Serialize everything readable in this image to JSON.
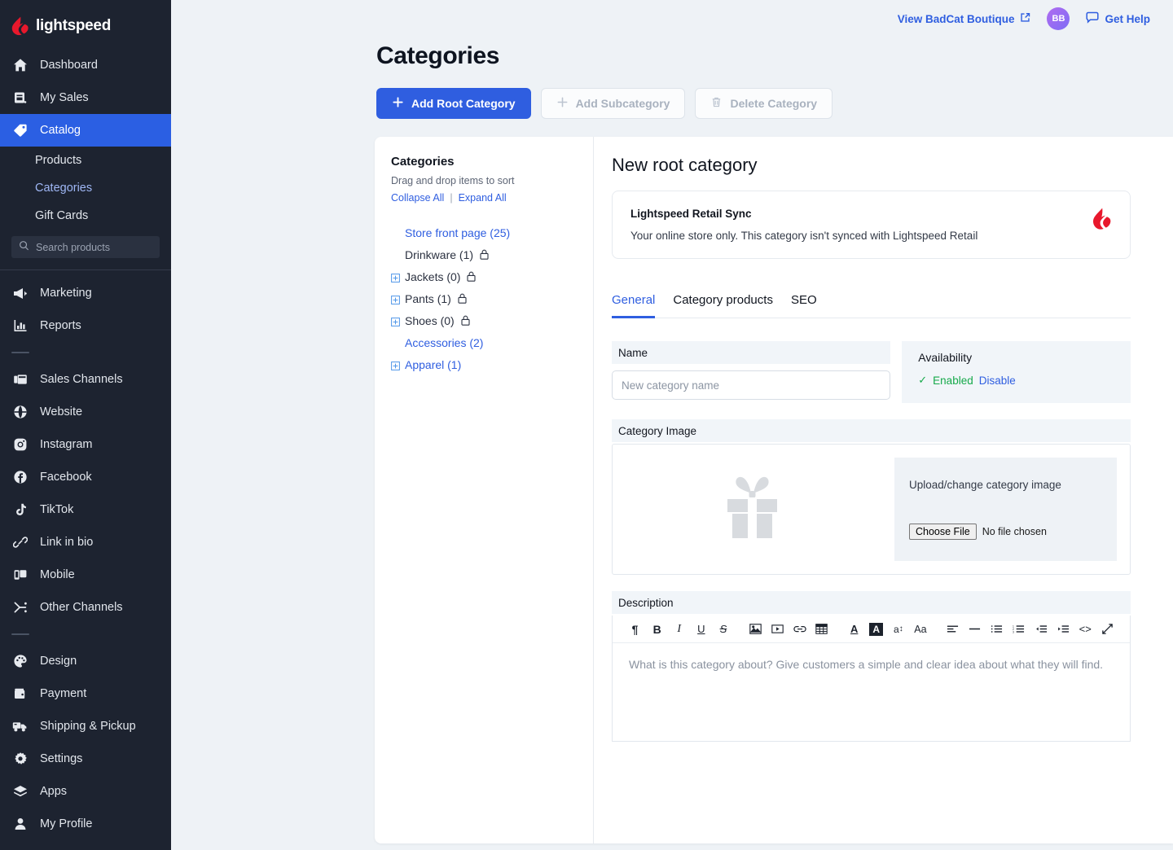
{
  "brand": {
    "name": "lightspeed"
  },
  "topbar": {
    "view_store": "View BadCat Boutique",
    "avatar_initials": "BB",
    "get_help": "Get Help"
  },
  "page": {
    "title": "Categories"
  },
  "actions": {
    "add_root": "Add Root Category",
    "add_sub": "Add Subcategory",
    "delete": "Delete Category"
  },
  "sidebar": {
    "search_placeholder": "Search products",
    "items": [
      {
        "label": "Dashboard",
        "icon": "home-icon"
      },
      {
        "label": "My Sales",
        "icon": "receipt-icon"
      },
      {
        "label": "Catalog",
        "icon": "tag-icon"
      }
    ],
    "catalog_sub": [
      {
        "label": "Products"
      },
      {
        "label": "Categories"
      },
      {
        "label": "Gift Cards"
      }
    ],
    "group2": [
      {
        "label": "Marketing",
        "icon": "megaphone-icon"
      },
      {
        "label": "Reports",
        "icon": "bar-chart-icon"
      }
    ],
    "group3": [
      {
        "label": "Sales Channels",
        "icon": "windows-icon"
      },
      {
        "label": "Website",
        "icon": "globe-icon"
      },
      {
        "label": "Instagram",
        "icon": "instagram-icon"
      },
      {
        "label": "Facebook",
        "icon": "facebook-icon"
      },
      {
        "label": "TikTok",
        "icon": "tiktok-icon"
      },
      {
        "label": "Link in bio",
        "icon": "link-icon"
      },
      {
        "label": "Mobile",
        "icon": "mobile-icon"
      },
      {
        "label": "Other Channels",
        "icon": "share-icon"
      }
    ],
    "group4": [
      {
        "label": "Design",
        "icon": "palette-icon"
      },
      {
        "label": "Payment",
        "icon": "wallet-icon"
      },
      {
        "label": "Shipping & Pickup",
        "icon": "truck-icon"
      },
      {
        "label": "Settings",
        "icon": "gear-icon"
      },
      {
        "label": "Apps",
        "icon": "layers-icon"
      },
      {
        "label": "My Profile",
        "icon": "user-icon"
      }
    ]
  },
  "tree": {
    "title": "Categories",
    "hint": "Drag and drop items to sort",
    "collapse_all": "Collapse All",
    "separator": "|",
    "expand_all": "Expand All",
    "items": [
      {
        "label": "Store front page (25)",
        "expandable": false,
        "locked": false,
        "link": true,
        "indent": true
      },
      {
        "label": "Drinkware (1)",
        "expandable": false,
        "locked": true,
        "link": false,
        "indent": true
      },
      {
        "label": "Jackets (0)",
        "expandable": true,
        "locked": true,
        "link": false,
        "indent": false
      },
      {
        "label": "Pants (1)",
        "expandable": true,
        "locked": true,
        "link": false,
        "indent": false
      },
      {
        "label": "Shoes (0)",
        "expandable": true,
        "locked": true,
        "link": false,
        "indent": false
      },
      {
        "label": "Accessories (2)",
        "expandable": false,
        "locked": false,
        "link": true,
        "indent": true
      },
      {
        "label": "Apparel (1)",
        "expandable": true,
        "locked": false,
        "link": true,
        "indent": false
      }
    ]
  },
  "detail": {
    "title": "New root category",
    "sync": {
      "title": "Lightspeed Retail Sync",
      "text": "Your online store only. This category isn't synced with Lightspeed Retail"
    },
    "tabs": [
      {
        "label": "General",
        "active": true
      },
      {
        "label": "Category products",
        "active": false
      },
      {
        "label": "SEO",
        "active": false
      }
    ],
    "name": {
      "label": "Name",
      "value": "",
      "placeholder": "New category name"
    },
    "availability": {
      "label": "Availability",
      "enabled_label": "Enabled",
      "disable_label": "Disable",
      "check_glyph": "✓"
    },
    "image": {
      "label": "Category Image",
      "upload_label": "Upload/change category image",
      "choose_file": "Choose File",
      "file_status": "No file chosen",
      "thumb_icon": "gift-icon"
    },
    "description": {
      "label": "Description",
      "placeholder": "What is this category about? Give customers a simple and clear idea about what they will find.",
      "value": "",
      "toolbar": [
        {
          "name": "paragraph-icon",
          "glyph": "¶"
        },
        {
          "name": "bold-icon",
          "glyph": "B"
        },
        {
          "name": "italic-icon",
          "glyph": "I"
        },
        {
          "name": "underline-icon",
          "glyph": "U"
        },
        {
          "name": "strikethrough-icon",
          "glyph": "S"
        },
        {
          "name": "insert-image-icon",
          "glyph": ""
        },
        {
          "name": "insert-video-icon",
          "glyph": ""
        },
        {
          "name": "insert-link-icon",
          "glyph": ""
        },
        {
          "name": "insert-table-icon",
          "glyph": ""
        },
        {
          "name": "text-color-icon",
          "glyph": "A"
        },
        {
          "name": "highlight-color-icon",
          "glyph": "A"
        },
        {
          "name": "font-size-icon",
          "glyph": "a"
        },
        {
          "name": "font-family-icon",
          "glyph": "Aa"
        },
        {
          "name": "align-icon",
          "glyph": ""
        },
        {
          "name": "horizontal-rule-icon",
          "glyph": ""
        },
        {
          "name": "bulleted-list-icon",
          "glyph": ""
        },
        {
          "name": "numbered-list-icon",
          "glyph": ""
        },
        {
          "name": "outdent-icon",
          "glyph": ""
        },
        {
          "name": "indent-icon",
          "glyph": ""
        },
        {
          "name": "source-code-icon",
          "glyph": "<>"
        },
        {
          "name": "fullscreen-icon",
          "glyph": ""
        }
      ]
    }
  },
  "colors": {
    "accent": "#2f5ee0",
    "sidebar_bg": "#1d2330",
    "brand_red": "#e8182c",
    "success_green": "#15a94a",
    "page_bg": "#eef2f6"
  }
}
